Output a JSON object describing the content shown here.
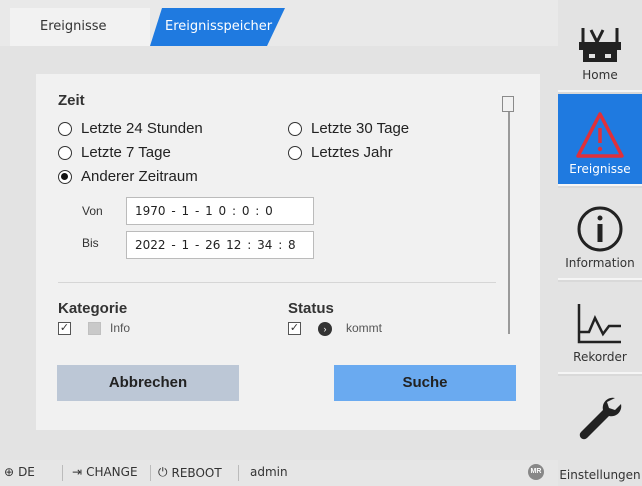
{
  "tabs": [
    {
      "label": "Ereignisse"
    },
    {
      "label": "Ereignisspeicher"
    }
  ],
  "filter": {
    "time_title": "Zeit",
    "options": [
      {
        "label": "Letzte 24 Stunden",
        "checked": false
      },
      {
        "label": "Letzte 30 Tage",
        "checked": false
      },
      {
        "label": "Letzte 7 Tage",
        "checked": false
      },
      {
        "label": "Letztes Jahr",
        "checked": false
      },
      {
        "label": "Anderer Zeitraum",
        "checked": true
      }
    ],
    "from_label": "Von",
    "from_value": "1970 - 1   - 1      0  : 0   : 0",
    "to_label": "Bis",
    "to_value": "2022 - 1   - 26    12 : 34 : 8",
    "category_title": "Kategorie",
    "category_item": "Info",
    "status_title": "Status",
    "status_item": "kommt"
  },
  "buttons": {
    "cancel": "Abbrechen",
    "search": "Suche"
  },
  "statusbar": {
    "language": "DE",
    "change": "CHANGE",
    "reboot": "REBOOT",
    "user": "admin",
    "badge": "MR"
  },
  "nav": [
    {
      "label": "Home",
      "icon": "transformer-icon",
      "active": false
    },
    {
      "label": "Ereignisse",
      "icon": "warning-icon",
      "active": true
    },
    {
      "label": "Information",
      "icon": "info-icon",
      "active": false
    },
    {
      "label": "Rekorder",
      "icon": "chart-icon",
      "active": false
    },
    {
      "label": "Einstellungen",
      "icon": "wrench-icon",
      "active": false
    }
  ],
  "colors": {
    "accent": "#1f7ae0",
    "search_button": "#6aaaf0",
    "cancel_button": "#bcc7d6"
  }
}
